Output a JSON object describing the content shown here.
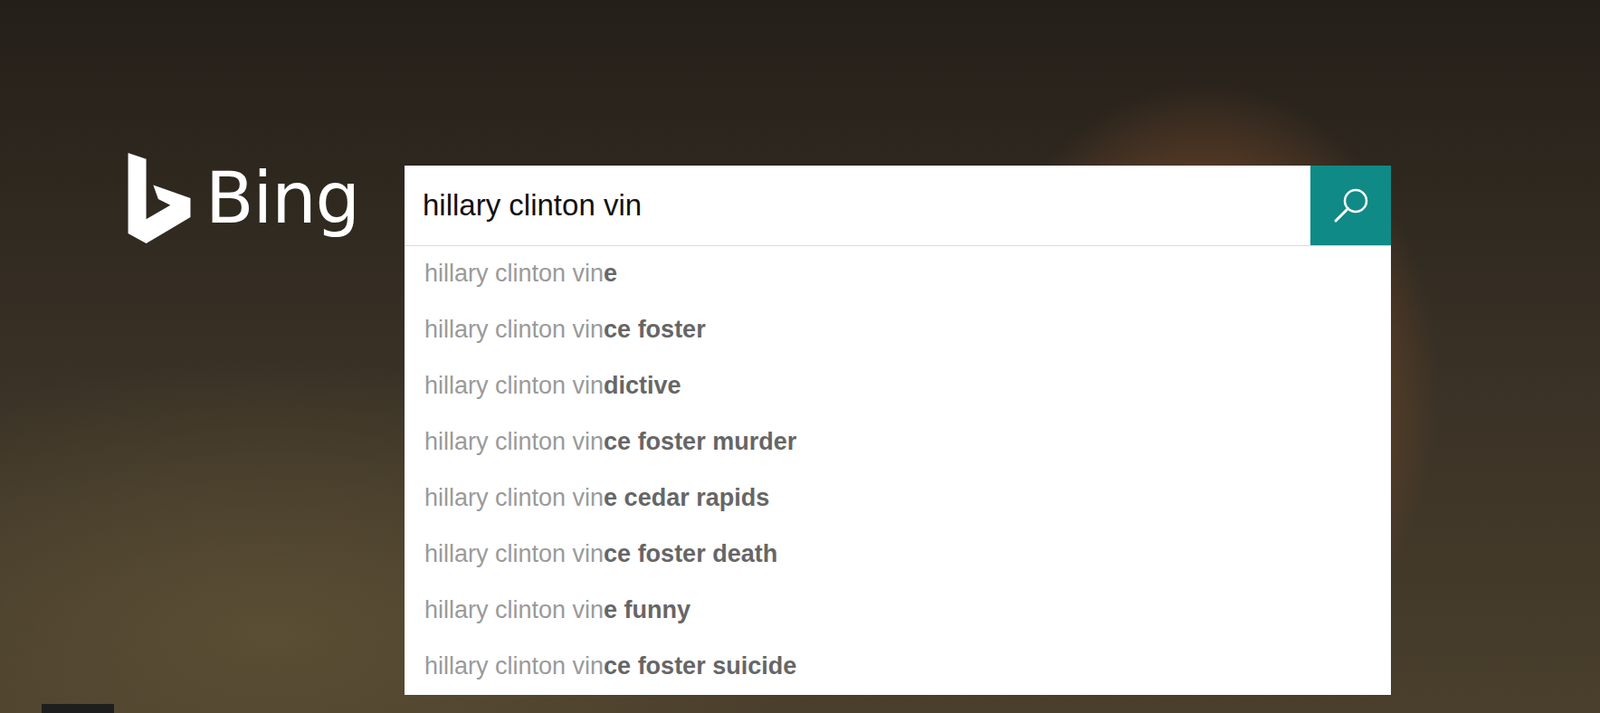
{
  "logo": {
    "text": "Bing"
  },
  "search": {
    "value": "hillary clinton vin"
  },
  "suggestions": [
    {
      "prefix": "hillary clinton vin",
      "completion": "e"
    },
    {
      "prefix": "hillary clinton vin",
      "completion": "ce foster"
    },
    {
      "prefix": "hillary clinton vin",
      "completion": "dictive"
    },
    {
      "prefix": "hillary clinton vin",
      "completion": "ce foster murder"
    },
    {
      "prefix": "hillary clinton vin",
      "completion": "e cedar rapids"
    },
    {
      "prefix": "hillary clinton vin",
      "completion": "ce foster death"
    },
    {
      "prefix": "hillary clinton vin",
      "completion": "e funny"
    },
    {
      "prefix": "hillary clinton vin",
      "completion": "ce foster suicide"
    }
  ]
}
